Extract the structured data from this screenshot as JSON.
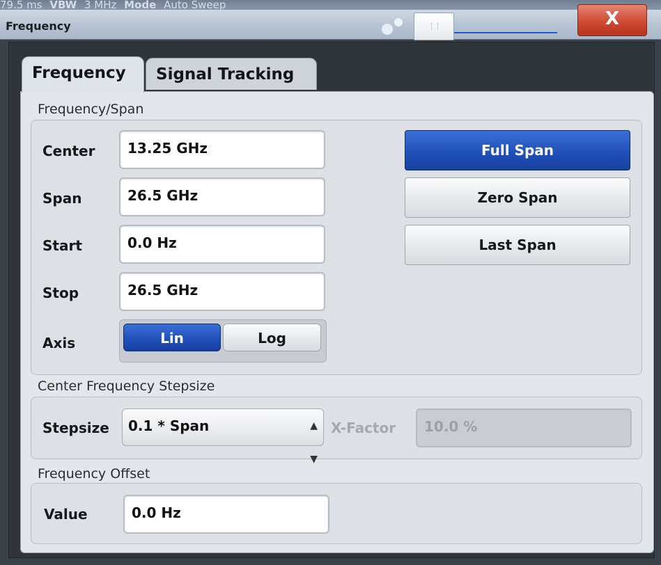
{
  "background_status": {
    "sweep_time": "79.5 ms",
    "vbw_label": "VBW",
    "vbw_value": "3 MHz",
    "mode_label": "Mode",
    "mode_value": "Auto Sweep"
  },
  "window": {
    "title": "Frequency",
    "close_label": "X"
  },
  "tabs": [
    {
      "label": "Frequency",
      "active": true
    },
    {
      "label": "Signal Tracking",
      "active": false
    }
  ],
  "frequency_span": {
    "title": "Frequency/Span",
    "center_label": "Center",
    "center_value": "13.25 GHz",
    "span_label": "Span",
    "span_value": "26.5 GHz",
    "start_label": "Start",
    "start_value": "0.0 Hz",
    "stop_label": "Stop",
    "stop_value": "26.5 GHz",
    "axis_label": "Axis",
    "axis_options": [
      "Lin",
      "Log"
    ],
    "axis_selected": "Lin",
    "full_span_label": "Full Span",
    "zero_span_label": "Zero Span",
    "last_span_label": "Last Span"
  },
  "stepsize": {
    "title": "Center Frequency Stepsize",
    "stepsize_label": "Stepsize",
    "stepsize_value": "0.1 * Span",
    "xfactor_label": "X-Factor",
    "xfactor_value": "10.0 %"
  },
  "offset": {
    "title": "Frequency Offset",
    "value_label": "Value",
    "value": "0.0 Hz"
  },
  "colors": {
    "accent_blue": "#1f4fb8",
    "close_red": "#cf4a33",
    "panel_bg": "#e3e7eb",
    "dialog_bg": "#2f353b"
  }
}
